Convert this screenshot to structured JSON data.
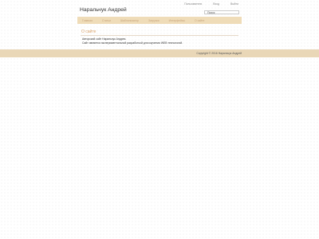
{
  "header": {
    "top_links": [
      "Пользователи",
      "Вход",
      "Выйти"
    ],
    "site_title": "Наральчук Андрей",
    "search_placeholder": "Поиск"
  },
  "nav": {
    "items": [
      "Главная",
      "Статьи",
      "Шаблонизатор",
      "Загрузки",
      "Интерфейсы",
      "О сайте"
    ]
  },
  "main": {
    "heading": "О сайте",
    "lines": [
      "Авторский сайт Наральчук Андрея.",
      "Сайт является экспериментальной разработкой для изучения WEB технологий."
    ]
  },
  "footer": {
    "copyright": "Copyright © 2016 Наральчук Андрей"
  },
  "colors": {
    "navbar_bg": "#efdcb8",
    "nav_text": "#c7a57e",
    "heading_accent": "#d8a068",
    "footer_bg": "#e9d7b7"
  }
}
